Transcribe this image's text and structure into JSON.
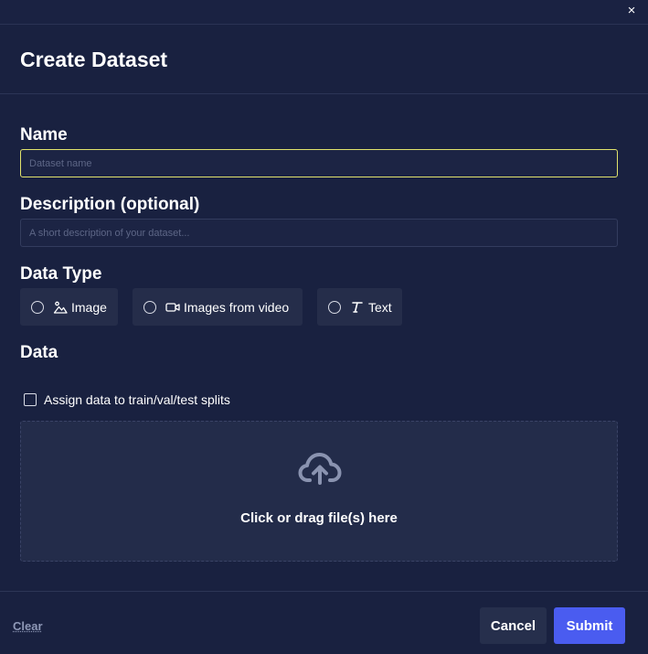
{
  "dialog": {
    "title": "Create Dataset",
    "close_glyph": "×"
  },
  "form": {
    "name": {
      "label": "Name",
      "placeholder": "Dataset name",
      "value": ""
    },
    "description": {
      "label": "Description (optional)",
      "placeholder": "A short description of your dataset...",
      "value": ""
    },
    "data_type": {
      "label": "Data Type",
      "options": [
        {
          "label": "Image",
          "icon": "image-icon",
          "selected": false
        },
        {
          "label": "Images from video",
          "icon": "video-icon",
          "selected": false
        },
        {
          "label": "Text",
          "icon": "text-icon",
          "selected": false
        }
      ]
    },
    "data": {
      "label": "Data",
      "split_checkbox_label": "Assign data to train/val/test splits",
      "split_checked": false,
      "dropzone_text": "Click or drag file(s) here",
      "dropzone_icon": "cloud-upload-icon"
    }
  },
  "footer": {
    "clear_label": "Clear",
    "cancel_label": "Cancel",
    "submit_label": "Submit"
  },
  "colors": {
    "background": "#192140",
    "accent": "#4a5cf0",
    "focus_border": "#e1e36c"
  }
}
